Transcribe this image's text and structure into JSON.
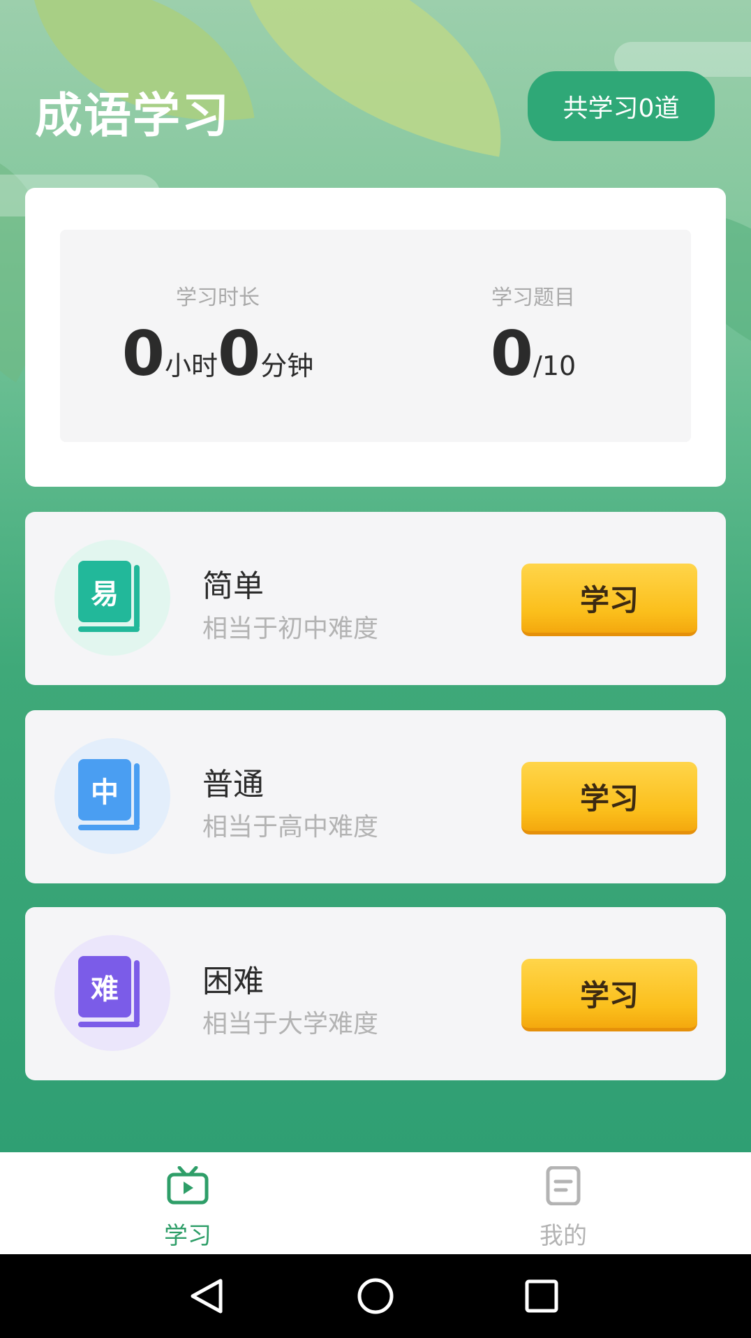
{
  "header": {
    "title": "成语学习",
    "total_label": "共学习0道"
  },
  "stats": {
    "duration": {
      "label": "学习时长",
      "hours": "0",
      "hours_unit": "小时",
      "minutes": "0",
      "minutes_unit": "分钟"
    },
    "questions": {
      "label": "学习题目",
      "done": "0",
      "total": "/10"
    }
  },
  "levels": [
    {
      "badge": "易",
      "name": "简单",
      "desc": "相当于初中难度",
      "button": "学习",
      "color": "#22b89a",
      "bg": "#e2f6ef"
    },
    {
      "badge": "中",
      "name": "普通",
      "desc": "相当于高中难度",
      "button": "学习",
      "color": "#4a9ef2",
      "bg": "#e3eefb"
    },
    {
      "badge": "难",
      "name": "困难",
      "desc": "相当于大学难度",
      "button": "学习",
      "color": "#7b5ce8",
      "bg": "#ebe6fb"
    }
  ],
  "tabbar": {
    "items": [
      {
        "label": "学习",
        "icon": "tv-icon",
        "active": true
      },
      {
        "label": "我的",
        "icon": "document-icon",
        "active": false
      }
    ],
    "active_color": "#2e9e68",
    "inactive_color": "#b3b3b3"
  },
  "navbar": {
    "icons": [
      "back-icon",
      "home-icon",
      "recents-icon"
    ]
  }
}
